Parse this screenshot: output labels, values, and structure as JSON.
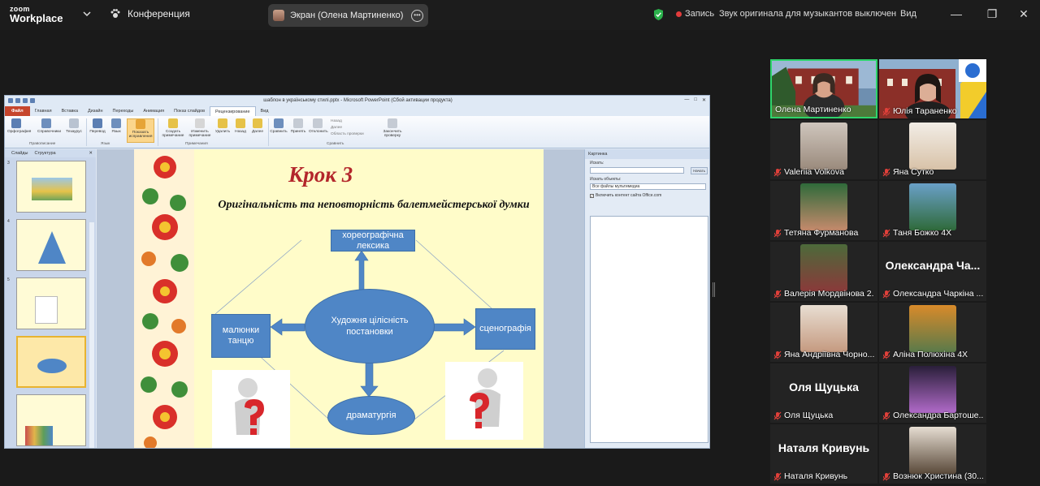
{
  "topbar": {
    "logo_top": "zoom",
    "logo_bottom": "Workplace",
    "meeting_label": "Конференция",
    "screen_share_label": "Экран (Олена Мартиненко)",
    "record_label": "Запись",
    "original_sound_label": "Звук оригинала для музыкантов выключен",
    "view_label": "Вид"
  },
  "ppt": {
    "window_title": "шаблон в українському стилі.pptx  -  Microsoft PowerPoint (Сбой активации продукта)",
    "tabs": [
      "Файл",
      "Главная",
      "Вставка",
      "Дизайн",
      "Переходы",
      "Анимация",
      "Показ слайдов",
      "Рецензирование",
      "Вид"
    ],
    "active_tab": "Рецензирование",
    "ribbon_buttons": [
      "Орфография",
      "Справочники",
      "Тезаурус",
      "Перевод",
      "Язык",
      "Показать исправления",
      "Создать примечание",
      "Изменить примечание",
      "Удалить",
      "Назад",
      "Далее",
      "Сравнить",
      "Принять",
      "Отклонить",
      "Закончить проверку"
    ],
    "ribbon_small": [
      "Назад",
      "Далее",
      "Область проверки"
    ],
    "ribbon_groups": [
      "Правописание",
      "Язык",
      "Примечания",
      "Сравнить"
    ],
    "panel_tabs": [
      "Слайды",
      "Структура"
    ],
    "slide_numbers": [
      "3",
      "4",
      "5"
    ],
    "slide": {
      "title": "Крок 3",
      "subtitle": "Оригінальність та неповторність балетмейстерської думки",
      "top_box": "хореографічна лексика",
      "left_box": "малюнки танцю",
      "right_box": "сценографія",
      "center": "Художня цілісність постановки",
      "bottom": "драматургія"
    },
    "clipart_pane": {
      "header": "Картинка",
      "search_label": "Искать:",
      "search_button": "Начать",
      "results_label": "Искать объекты:",
      "results_value": "Все файлы мультимедиа",
      "checkbox_label": "Включить контент сайта Office.com"
    }
  },
  "participants": [
    {
      "name": "Олена Мартиненко",
      "type": "video",
      "muted": false,
      "speaking": true
    },
    {
      "name": "Юлія Тараненко",
      "type": "video",
      "muted": true,
      "speaking": false
    },
    {
      "name": "Valeriia Volkova",
      "type": "photo",
      "muted": true
    },
    {
      "name": "Яна Сутко",
      "type": "photo",
      "muted": true
    },
    {
      "name": "Тетяна Фурманова",
      "type": "photo",
      "muted": true
    },
    {
      "name": "Таня Божко 4Х",
      "type": "photo",
      "muted": true
    },
    {
      "name": "Валерія Мордвінова 2...",
      "type": "photo",
      "muted": true
    },
    {
      "name": "Олександра Чаркіна ...",
      "type": "text",
      "muted": true,
      "display": "Олександра  Ча..."
    },
    {
      "name": "Яна Андріївна Чорно...",
      "type": "photo",
      "muted": true
    },
    {
      "name": "Аліна Полюхіна 4Х",
      "type": "photo",
      "muted": true
    },
    {
      "name": "Оля Щуцька",
      "type": "text",
      "muted": true,
      "display": "Оля Щуцька"
    },
    {
      "name": "Олександра Бартоше...",
      "type": "photo",
      "muted": true
    },
    {
      "name": "Наталя Кривунь",
      "type": "text",
      "muted": true,
      "display": "Наталя Кривунь"
    },
    {
      "name": "Вознюк Христина (30...",
      "type": "photo",
      "muted": true
    }
  ],
  "colors": {
    "speaking_border": "#2ed46b",
    "muted_icon": "#e0403a",
    "record_dot": "#e23c3c",
    "slide_title": "#b3262b",
    "diagram_fill": "#4f86c6"
  }
}
